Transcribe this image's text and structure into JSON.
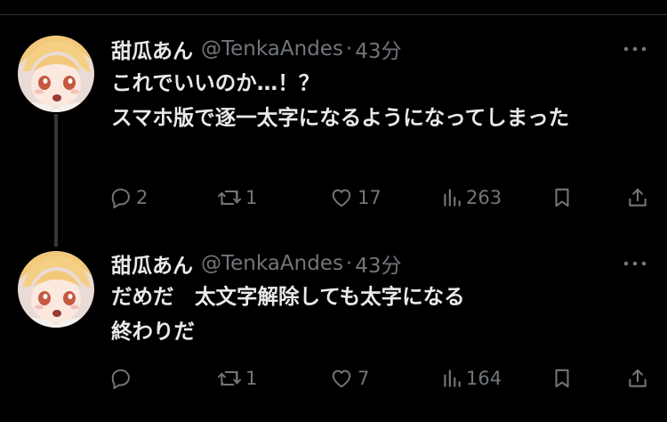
{
  "tweets": [
    {
      "author_name": "甜瓜あん",
      "handle": "@TenkaAndes",
      "separator": "·",
      "time": "43分",
      "text": "これでいいのか…！？\nスマホ版で逐一太字になるようになってしま​った",
      "replies": "2",
      "retweets": "1",
      "likes": "17",
      "views": "263"
    },
    {
      "author_name": "甜瓜あん",
      "handle": "@TenkaAndes",
      "separator": "·",
      "time": "43分",
      "text": "だめだ　太文字解除しても太字になる\n終わりだ",
      "replies": "",
      "retweets": "1",
      "likes": "7",
      "views": "164"
    }
  ],
  "icons": {
    "reply": "reply-icon",
    "retweet": "retweet-icon",
    "like": "heart-icon",
    "views": "views-icon",
    "bookmark": "bookmark-icon",
    "share": "share-icon",
    "more": "more-icon"
  },
  "colors": {
    "background": "#000000",
    "text": "#e7e9ea",
    "secondary": "#71767b",
    "thread_line": "#333639"
  }
}
